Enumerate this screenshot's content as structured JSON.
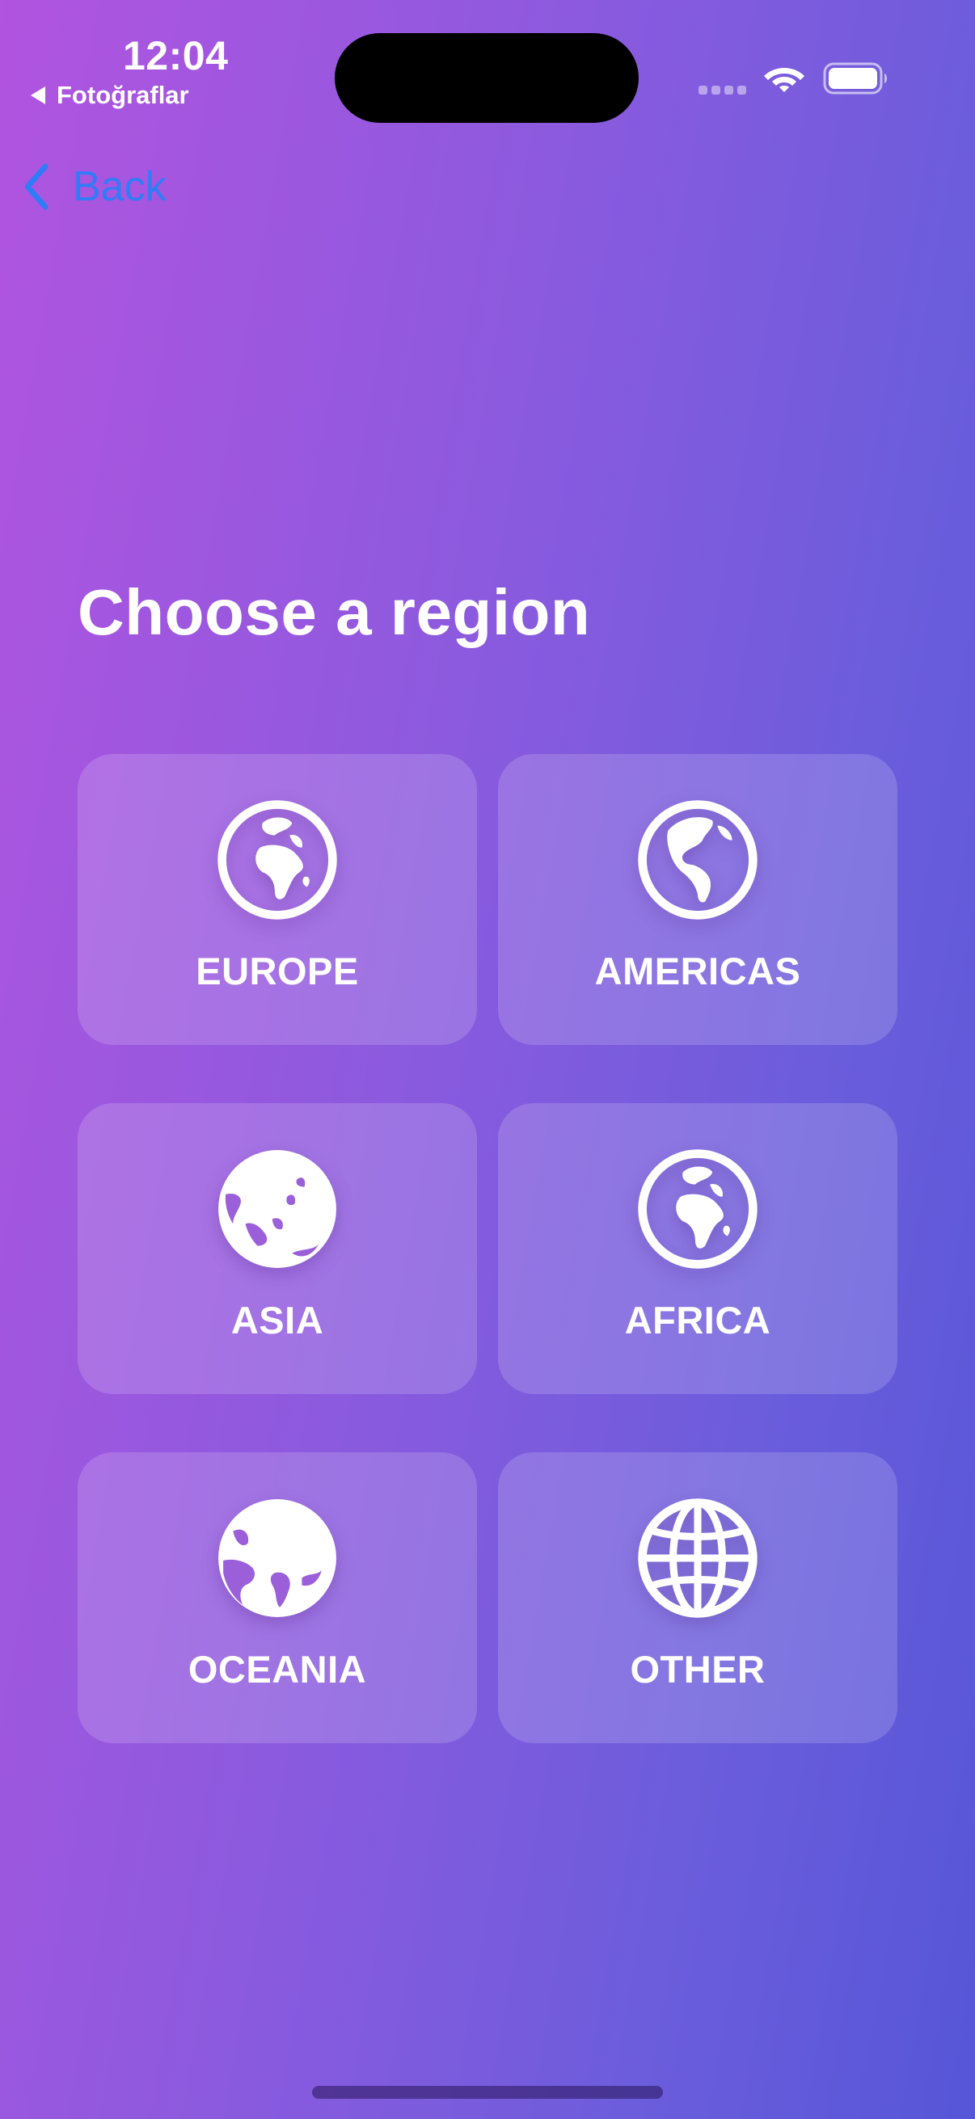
{
  "status_bar": {
    "time": "12:04",
    "back_app_label": "Fotoğraflar",
    "icons": [
      "signal-icon",
      "wifi-icon",
      "battery-icon"
    ]
  },
  "nav": {
    "back_label": "Back",
    "back_color": "#2f7cf6"
  },
  "page": {
    "title": "Choose a region"
  },
  "regions": [
    {
      "label": "EUROPE",
      "icon": "globe-europe-africa-icon"
    },
    {
      "label": "AMERICAS",
      "icon": "globe-americas-icon"
    },
    {
      "label": "ASIA",
      "icon": "globe-asia-australia-icon"
    },
    {
      "label": "AFRICA",
      "icon": "globe-europe-africa-icon"
    },
    {
      "label": "OCEANIA",
      "icon": "globe-central-south-asia-icon"
    },
    {
      "label": "OTHER",
      "icon": "globe-icon"
    }
  ],
  "colors": {
    "gradient_start": "#b154e0",
    "gradient_end": "#5656d8",
    "text": "#ffffff",
    "tile_background": "rgba(255,255,255,0.16)"
  }
}
